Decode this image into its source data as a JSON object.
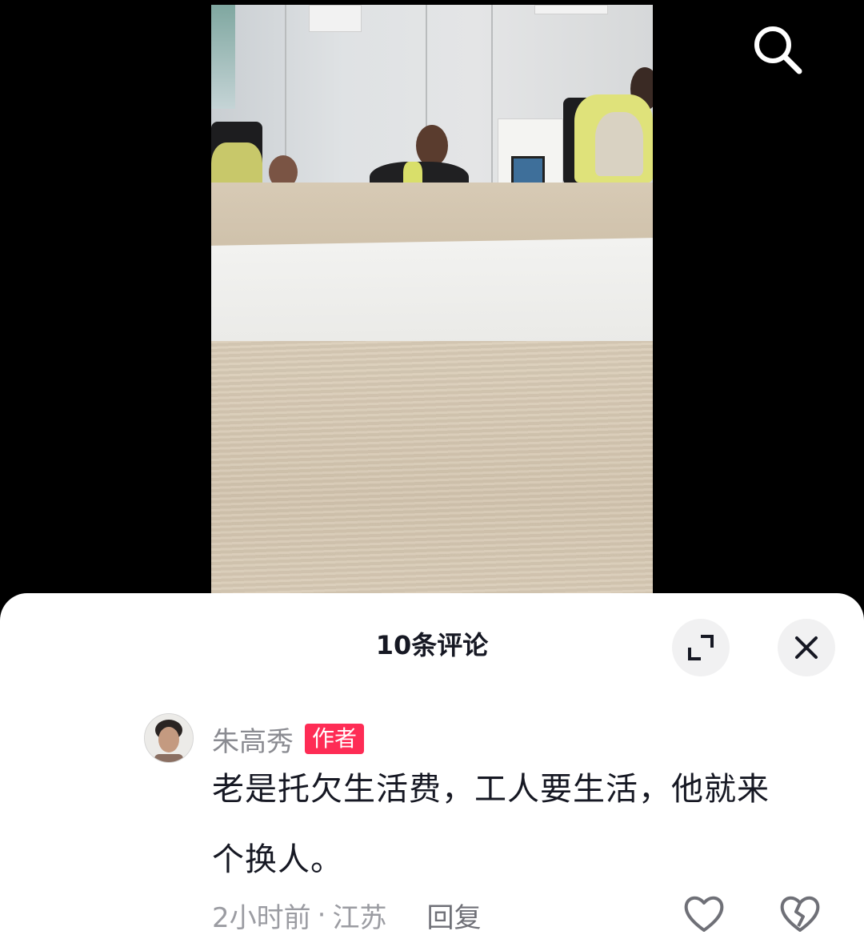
{
  "video": {
    "search_icon": "search-icon"
  },
  "comments_panel": {
    "title": "10条评论",
    "expand_icon": "expand-icon",
    "close_icon": "close-icon",
    "comment": {
      "author": "朱高秀",
      "badge": "作者",
      "text_line1": "老是托欠生活费，工人要生活，他就来",
      "text_line2": "个换人。",
      "time": "2小时前",
      "separator": "·",
      "location": "江苏",
      "reply_label": "回复",
      "like_icon": "heart-icon",
      "dislike_icon": "broken-heart-icon"
    }
  }
}
